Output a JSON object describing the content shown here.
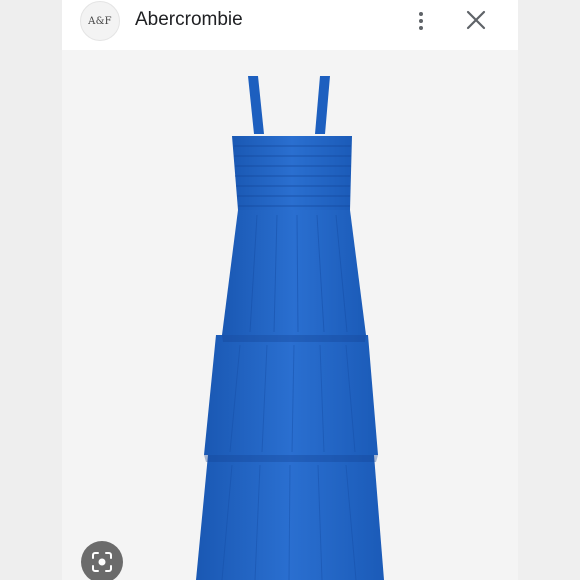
{
  "header": {
    "logo_text": "A&F",
    "site_name": "Abercrombie"
  },
  "icons": {
    "more": "more-vert-icon",
    "close": "close-icon",
    "lens": "lens-search-icon"
  },
  "colors": {
    "dress_blue": "#1f64c4",
    "background": "#f4f4f4"
  }
}
